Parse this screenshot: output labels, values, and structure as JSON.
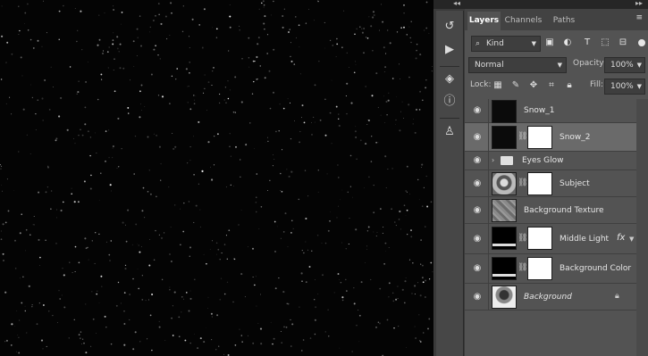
{
  "topbar": {
    "collapse_left": "◂◂",
    "collapse_right": "▸▸"
  },
  "tabs": [
    {
      "label": "Layers",
      "active": true
    },
    {
      "label": "Channels",
      "active": false
    },
    {
      "label": "Paths",
      "active": false
    }
  ],
  "filter": {
    "kind_label": "Kind",
    "icons": [
      "image-filter-icon",
      "adjustment-filter-icon",
      "type-filter-icon",
      "shape-filter-icon",
      "smart-object-filter-icon"
    ]
  },
  "blend": {
    "mode": "Normal",
    "opacity_label": "Opacity:",
    "opacity_value": "100%"
  },
  "lock": {
    "label": "Lock:",
    "fill_label": "Fill:",
    "fill_value": "100%"
  },
  "layers": [
    {
      "name": "Snow_1",
      "selected": false
    },
    {
      "name": "Snow_2",
      "selected": true
    },
    {
      "name": "Eyes Glow",
      "selected": false
    },
    {
      "name": "Subject",
      "selected": false
    },
    {
      "name": "Background Texture",
      "selected": false
    },
    {
      "name": "Middle Light",
      "selected": false,
      "fx": "fx"
    },
    {
      "name": "Background Color",
      "selected": false
    },
    {
      "name": "Background",
      "selected": false
    }
  ]
}
